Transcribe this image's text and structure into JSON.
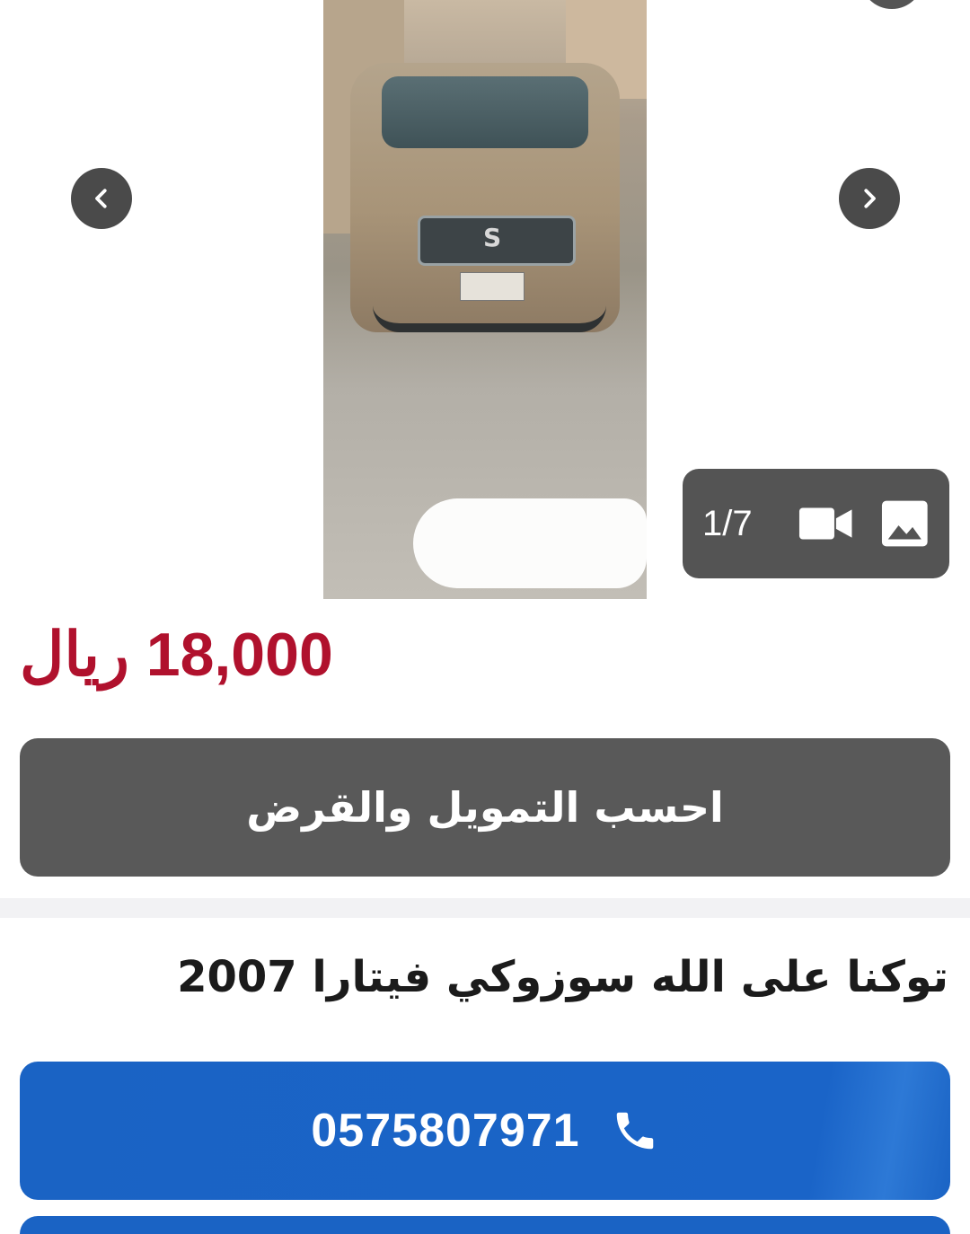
{
  "gallery": {
    "counter_text": "1/7",
    "prev_icon": "chevron-left-icon",
    "next_icon": "chevron-right-icon",
    "media_icons": [
      "video-camera-icon",
      "image-icon"
    ]
  },
  "listing": {
    "price": "18,000 ريال",
    "finance_button_label": "احسب التمويل والقرض",
    "title": "توكنا على الله سوزوكي فيتارا 2007",
    "phone_number": "0575807971"
  },
  "colors": {
    "price": "#b0112d",
    "finance_button": "#595959",
    "call_button": "#1a63c4"
  }
}
